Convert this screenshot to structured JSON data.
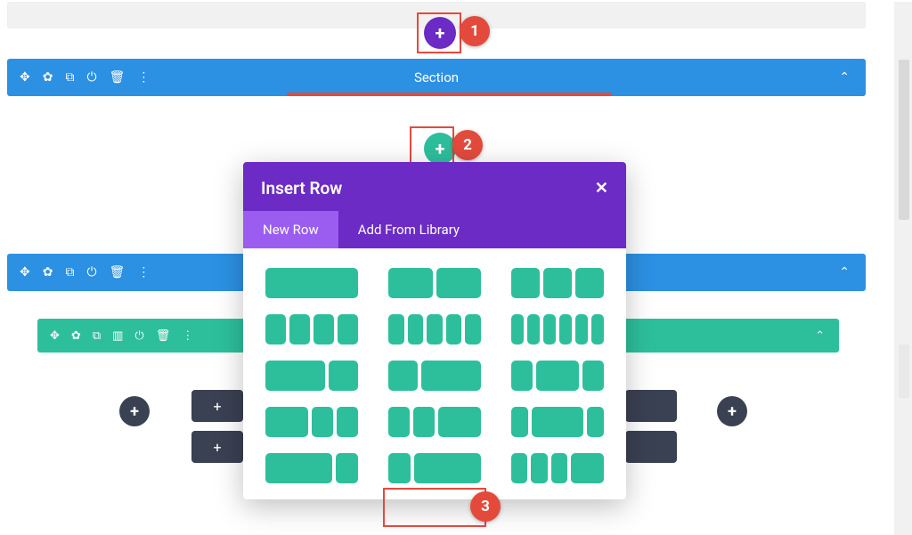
{
  "section": {
    "title": "Section",
    "tools": [
      "move",
      "gear",
      "duplicate",
      "power",
      "trash",
      "more"
    ],
    "tool_glyphs": {
      "move": "✥",
      "gear": "✿",
      "duplicate": "⧉",
      "power": "⏻",
      "trash": "🗑",
      "more": "⋮",
      "columns": "▥"
    }
  },
  "row": {
    "tools": [
      "move",
      "gear",
      "duplicate",
      "columns",
      "power",
      "trash",
      "more"
    ]
  },
  "modal": {
    "title": "Insert Row",
    "tabs": {
      "new": "New Row",
      "library": "Add From Library"
    },
    "active_tab": "new"
  },
  "callouts": {
    "c1": "1",
    "c2": "2",
    "c3": "3"
  },
  "glyphs": {
    "plus": "+",
    "close": "✕",
    "caret_up": "⌃"
  },
  "layouts": [
    [
      [
        1
      ]
    ],
    [
      [
        1,
        1
      ]
    ],
    [
      [
        1,
        1,
        1
      ]
    ],
    [
      [
        1,
        1,
        1,
        1
      ]
    ],
    [
      [
        1,
        1,
        1,
        1,
        1
      ]
    ],
    [
      [
        1,
        1,
        1,
        1,
        1,
        1
      ]
    ],
    [
      [
        2,
        1
      ]
    ],
    [
      [
        1,
        2
      ]
    ],
    [
      [
        1,
        2,
        1
      ]
    ],
    [
      [
        2,
        1,
        1
      ]
    ],
    [
      [
        1,
        1,
        2
      ]
    ],
    [
      [
        1,
        3,
        1
      ]
    ],
    [
      [
        3,
        1
      ]
    ],
    [
      [
        1,
        3
      ]
    ],
    [
      [
        1,
        1,
        1,
        2
      ]
    ]
  ]
}
